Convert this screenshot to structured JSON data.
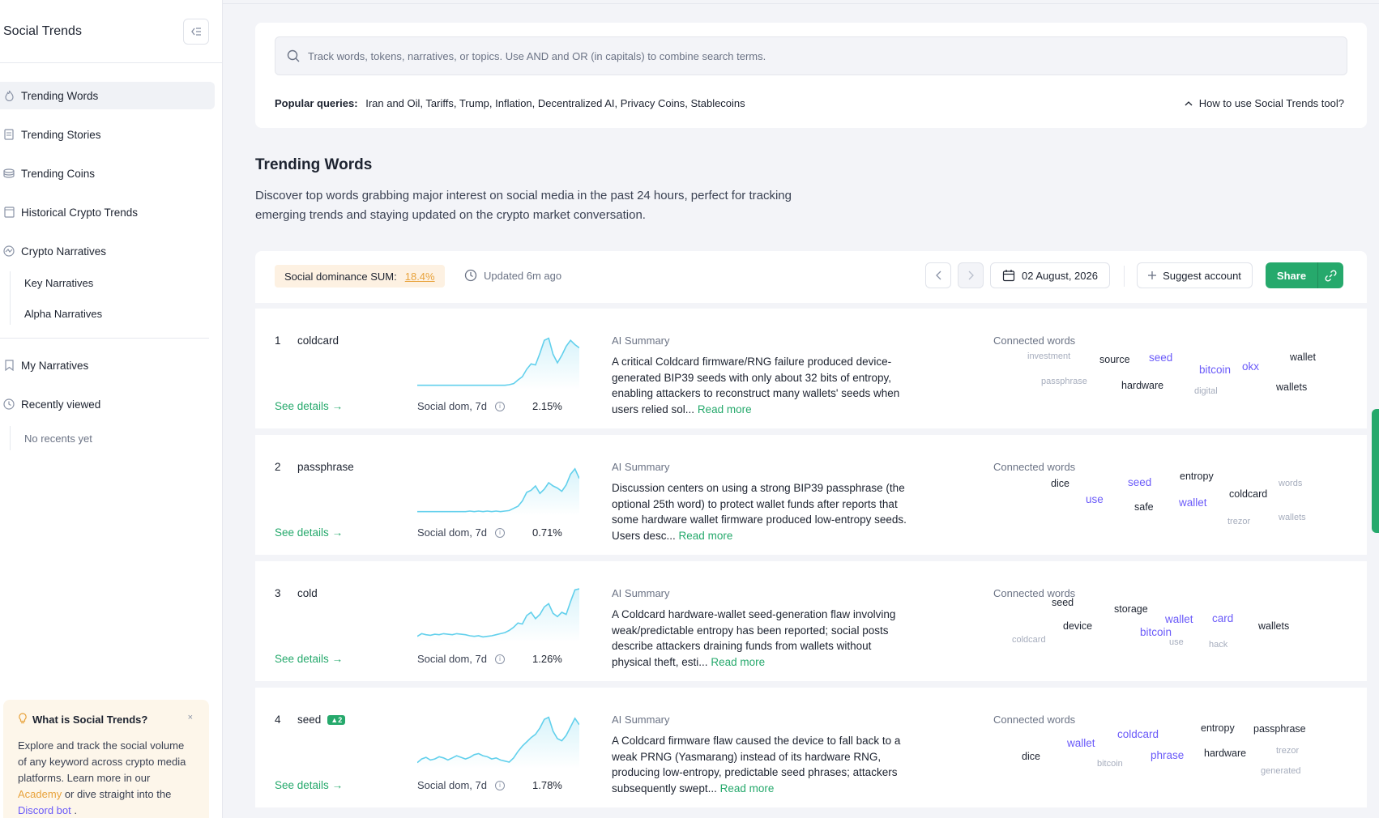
{
  "sidebar": {
    "title": "Social Trends",
    "nav": [
      {
        "label": "Trending Words",
        "icon": "flame-icon"
      },
      {
        "label": "Trending Stories",
        "icon": "document-icon"
      },
      {
        "label": "Trending Coins",
        "icon": "coins-icon"
      },
      {
        "label": "Historical Crypto Trends",
        "icon": "archive-icon"
      },
      {
        "label": "Crypto Narratives",
        "icon": "narratives-icon"
      }
    ],
    "narratives_sub": [
      "Key Narratives",
      "Alpha Narratives"
    ],
    "my_narratives": "My Narratives",
    "recently_viewed": "Recently viewed",
    "no_recents": "No recents yet",
    "info": {
      "title": "What is Social Trends?",
      "close": "×",
      "body_1": "Explore and track the social volume of any keyword across crypto media platforms. Learn more in our ",
      "academy": "Academy",
      "body_2": " or dive straight into the ",
      "discord": "Discord bot",
      "body_3": " ."
    }
  },
  "search": {
    "placeholder": "Track words, tokens, narratives, or topics. Use AND and OR (in capitals) to combine search terms.",
    "popular_label": "Popular queries:",
    "popular_list": "Iran and Oil, Tariffs, Trump, Inflation, Decentralized AI, Privacy Coins, Stablecoins",
    "howto": "How to use Social Trends tool?"
  },
  "section": {
    "title": "Trending Words",
    "description": "Discover top words grabbing major interest on social media in the past 24 hours, perfect for tracking emerging trends and staying updated on the crypto market conversation."
  },
  "toolbar": {
    "dominance_label": "Social dominance SUM:",
    "dominance_value": "18.4%",
    "updated": "Updated 6m ago",
    "date": "02 August, 2026",
    "suggest": "Suggest account",
    "share": "Share"
  },
  "row_labels": {
    "see_details": "See details",
    "social_dom": "Social dom, 7d",
    "ai_summary": "AI Summary",
    "read_more": "Read more",
    "connected_words": "Connected words"
  },
  "rows": [
    {
      "rank": "1",
      "word": "coldcard",
      "badge": "",
      "dom": "2.15%",
      "summary": "A critical Coldcard firmware/RNG failure produced device-generated BIP39 seeds with only about 32 bits of entropy, enabling attackers to reconstruct many wallets' seeds when users relied sol...",
      "spark": [
        0.02,
        0.02,
        0.02,
        0.02,
        0.02,
        0.02,
        0.02,
        0.02,
        0.02,
        0.02,
        0.02,
        0.02,
        0.02,
        0.02,
        0.02,
        0.02,
        0.02,
        0.02,
        0.02,
        0.02,
        0.02,
        0.03,
        0.05,
        0.12,
        0.18,
        0.32,
        0.42,
        0.4,
        0.62,
        0.86,
        0.9,
        0.6,
        0.44,
        0.58,
        0.75,
        0.86,
        0.78,
        0.72
      ]
    },
    {
      "rank": "2",
      "word": "passphrase",
      "badge": "",
      "dom": "0.71%",
      "summary": "Discussion centers on using a strong BIP39 passphrase (the optional 25th word) to protect wallet funds after reports that some hardware wallet firmware produced low-entropy seeds. Users desc...",
      "spark": [
        0.02,
        0.02,
        0.02,
        0.02,
        0.02,
        0.02,
        0.02,
        0.02,
        0.02,
        0.02,
        0.02,
        0.02,
        0.03,
        0.02,
        0.03,
        0.02,
        0.03,
        0.02,
        0.03,
        0.02,
        0.03,
        0.04,
        0.08,
        0.12,
        0.22,
        0.38,
        0.42,
        0.5,
        0.36,
        0.44,
        0.56,
        0.5,
        0.46,
        0.4,
        0.52,
        0.72,
        0.82,
        0.64
      ]
    },
    {
      "rank": "3",
      "word": "cold",
      "badge": "",
      "dom": "1.26%",
      "summary": "A Coldcard hardware-wallet seed-generation flaw involving weak/predictable entropy has been reported; social posts describe attackers draining funds from wallets without physical theft, esti...",
      "spark": [
        0.05,
        0.1,
        0.08,
        0.07,
        0.09,
        0.08,
        0.1,
        0.09,
        0.08,
        0.1,
        0.09,
        0.08,
        0.06,
        0.05,
        0.06,
        0.04,
        0.05,
        0.06,
        0.08,
        0.1,
        0.12,
        0.16,
        0.22,
        0.3,
        0.28,
        0.44,
        0.5,
        0.38,
        0.46,
        0.6,
        0.66,
        0.48,
        0.42,
        0.5,
        0.46,
        0.7,
        0.92,
        0.94
      ]
    },
    {
      "rank": "4",
      "word": "seed",
      "badge": "2",
      "dom": "1.78%",
      "summary": "A Coldcard firmware flaw caused the device to fall back to a weak PRNG (Yasmarang) instead of its hardware RNG, producing low-entropy, predictable seed phrases; attackers subsequently swept...",
      "spark": [
        0.05,
        0.12,
        0.15,
        0.1,
        0.12,
        0.16,
        0.14,
        0.1,
        0.14,
        0.18,
        0.15,
        0.12,
        0.15,
        0.2,
        0.22,
        0.18,
        0.16,
        0.12,
        0.14,
        0.1,
        0.08,
        0.06,
        0.14,
        0.26,
        0.36,
        0.44,
        0.52,
        0.58,
        0.7,
        0.86,
        0.9,
        0.64,
        0.5,
        0.46,
        0.56,
        0.72,
        0.88,
        0.76
      ]
    }
  ],
  "connected": [
    [
      {
        "w": "investment",
        "s": "s"
      },
      {
        "w": "source",
        "s": "m"
      },
      {
        "w": "seed",
        "s": "l"
      },
      {
        "w": "wallet",
        "s": "m"
      },
      {
        "w": "bitcoin",
        "s": "l"
      },
      {
        "w": "okx",
        "s": "l"
      },
      {
        "w": "passphrase",
        "s": "s"
      },
      {
        "w": "hardware",
        "s": "m"
      },
      {
        "w": "digital",
        "s": "s"
      },
      {
        "w": "wallets",
        "s": "m"
      }
    ],
    [
      {
        "w": "dice",
        "s": "m"
      },
      {
        "w": "seed",
        "s": "l"
      },
      {
        "w": "entropy",
        "s": "m"
      },
      {
        "w": "words",
        "s": "s"
      },
      {
        "w": "use",
        "s": "l"
      },
      {
        "w": "coldcard",
        "s": "m"
      },
      {
        "w": "safe",
        "s": "m"
      },
      {
        "w": "wallet",
        "s": "l"
      },
      {
        "w": "trezor",
        "s": "s"
      },
      {
        "w": "wallets",
        "s": "s"
      }
    ],
    [
      {
        "w": "seed",
        "s": "m"
      },
      {
        "w": "storage",
        "s": "m"
      },
      {
        "w": "device",
        "s": "m"
      },
      {
        "w": "wallet",
        "s": "l"
      },
      {
        "w": "card",
        "s": "l"
      },
      {
        "w": "bitcoin",
        "s": "l"
      },
      {
        "w": "wallets",
        "s": "m"
      },
      {
        "w": "coldcard",
        "s": "s"
      },
      {
        "w": "use",
        "s": "s"
      },
      {
        "w": "hack",
        "s": "s"
      }
    ],
    [
      {
        "w": "entropy",
        "s": "m"
      },
      {
        "w": "passphrase",
        "s": "m"
      },
      {
        "w": "coldcard",
        "s": "l"
      },
      {
        "w": "wallet",
        "s": "l"
      },
      {
        "w": "trezor",
        "s": "s"
      },
      {
        "w": "dice",
        "s": "m"
      },
      {
        "w": "phrase",
        "s": "l"
      },
      {
        "w": "hardware",
        "s": "m"
      },
      {
        "w": "bitcoin",
        "s": "s"
      },
      {
        "w": "generated",
        "s": "s"
      }
    ]
  ],
  "colors": {
    "accent": "#26a96c",
    "purple": "#6a5af9",
    "orange": "#e8a33d",
    "spark": "#62d0ec"
  }
}
